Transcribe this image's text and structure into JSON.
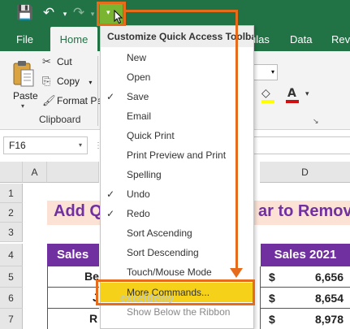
{
  "qat": {
    "save_icon": "💾",
    "undo_icon": "↶",
    "redo_icon": "↷",
    "dropdown_arrow": "▾",
    "customize_arrow": "▾"
  },
  "tabs": {
    "file": "File",
    "home": "Home",
    "formulas_partial": "ulas",
    "data": "Data",
    "review_partial": "Revi"
  },
  "clipboard": {
    "paste": "Paste",
    "paste_arrow": "▾",
    "cut": "Cut",
    "copy": "Copy",
    "copy_arrow": "▾",
    "format_painter": "Format Pa",
    "group_label": "Clipboard",
    "cut_icon": "✂",
    "copy_icon": "⎘",
    "format_icon": "🖌"
  },
  "font_group": {
    "dropdown_arrow": "▾",
    "fill_icon": "◇",
    "font_color_icon": "A",
    "more_icon": "▾",
    "launcher_icon": "↘"
  },
  "formula_bar": {
    "name_box": "F16",
    "name_box_arrow": "▾",
    "dots": "⋮"
  },
  "grid": {
    "columns": [
      "A",
      "D"
    ],
    "rows": [
      "1",
      "2",
      "3",
      "4",
      "5",
      "6",
      "7"
    ],
    "title_left": "Add Q",
    "title_right": "ar to Remov",
    "header_left": "Sales",
    "header_right": "Sales 2021",
    "row5_frag": "Be",
    "row6_frag": "J",
    "row7_frag": "R",
    "currency": "$",
    "values": [
      "6,656",
      "8,654",
      "8,978"
    ]
  },
  "menu": {
    "title": "Customize Quick Access Toolbar",
    "check_glyph": "✓",
    "items": [
      {
        "label": "New",
        "checked": false
      },
      {
        "label": "Open",
        "checked": false
      },
      {
        "label": "Save",
        "checked": true
      },
      {
        "label": "Email",
        "checked": false
      },
      {
        "label": "Quick Print",
        "checked": false
      },
      {
        "label": "Print Preview and Print",
        "checked": false
      },
      {
        "label": "Spelling",
        "checked": false
      },
      {
        "label": "Undo",
        "checked": true
      },
      {
        "label": "Redo",
        "checked": true
      },
      {
        "label": "Sort Ascending",
        "checked": false
      },
      {
        "label": "Sort Descending",
        "checked": false
      },
      {
        "label": "Touch/Mouse Mode",
        "checked": false
      },
      {
        "label": "More Commands...",
        "checked": false
      },
      {
        "label": "Show Below the Ribbon",
        "checked": false
      }
    ]
  },
  "watermark": "exceldemy",
  "colors": {
    "excel_green": "#217346",
    "purple": "#7030a0",
    "highlight": "#f5d11a",
    "annotation": "#e66c1c",
    "qat_customize": "#7ab531"
  }
}
